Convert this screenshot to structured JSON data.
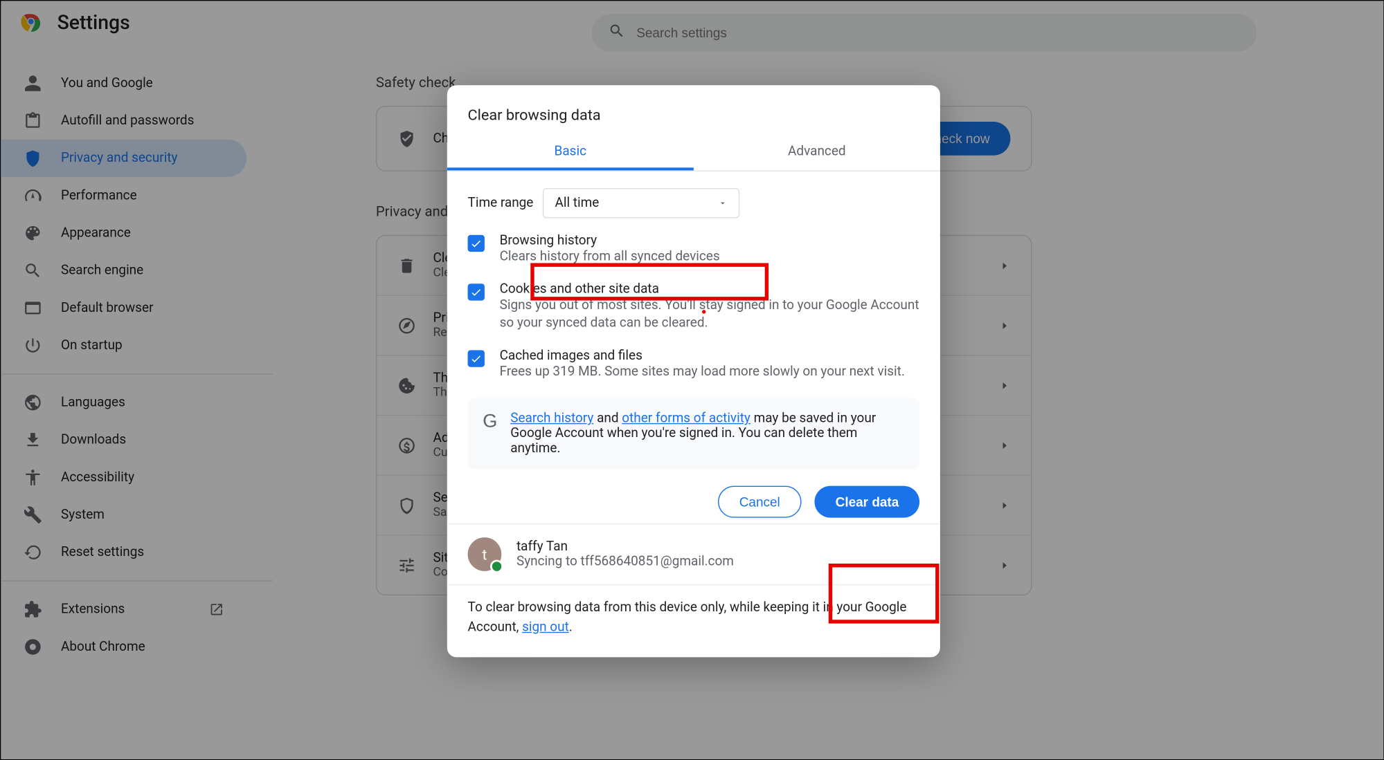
{
  "header": {
    "title": "Settings",
    "search_placeholder": "Search settings"
  },
  "sidebar": {
    "items": [
      {
        "label": "You and Google"
      },
      {
        "label": "Autofill and passwords"
      },
      {
        "label": "Privacy and security"
      },
      {
        "label": "Performance"
      },
      {
        "label": "Appearance"
      },
      {
        "label": "Search engine"
      },
      {
        "label": "Default browser"
      },
      {
        "label": "On startup"
      }
    ],
    "items2": [
      {
        "label": "Languages"
      },
      {
        "label": "Downloads"
      },
      {
        "label": "Accessibility"
      },
      {
        "label": "System"
      },
      {
        "label": "Reset settings"
      }
    ],
    "items3": [
      {
        "label": "Extensions"
      },
      {
        "label": "About Chrome"
      }
    ]
  },
  "main": {
    "safety_check_title": "Safety check",
    "safety_row_text": "Chro",
    "check_now": "Check now",
    "privacy_section_title": "Privacy and s",
    "rows": [
      {
        "t1": "Clea",
        "t2": "Clea"
      },
      {
        "t1": "Priv",
        "t2": "Revi"
      },
      {
        "t1": "Thir",
        "t2": "Thir"
      },
      {
        "t1": "Ad p",
        "t2": "Cust"
      },
      {
        "t1": "Secu",
        "t2": "Safe"
      },
      {
        "t1": "Site",
        "t2": "Con"
      }
    ]
  },
  "dialog": {
    "title": "Clear browsing data",
    "tabs": {
      "basic": "Basic",
      "advanced": "Advanced"
    },
    "time_range_label": "Time range",
    "time_range_value": "All time",
    "options": [
      {
        "title": "Browsing history",
        "desc": "Clears history from all synced devices"
      },
      {
        "title": "Cookies and other site data",
        "desc": "Signs you out of most sites. You'll stay signed in to your Google Account so your synced data can be cleared."
      },
      {
        "title": "Cached images and files",
        "desc": "Frees up 319 MB. Some sites may load more slowly on your next visit."
      }
    ],
    "info": {
      "search_history_link": "Search history",
      "mid": " and ",
      "other_forms_link": "other forms of activity",
      "tail": " may be saved in your Google Account when you're signed in. You can delete them anytime."
    },
    "cancel": "Cancel",
    "clear": "Clear data",
    "profile": {
      "initial": "t",
      "name": "taffy Tan",
      "sync_text": "Syncing to tff568640851@gmail.com"
    },
    "footer": {
      "text": "To clear browsing data from this device only, while keeping it in your Google Account, ",
      "sign_out": "sign out"
    }
  }
}
